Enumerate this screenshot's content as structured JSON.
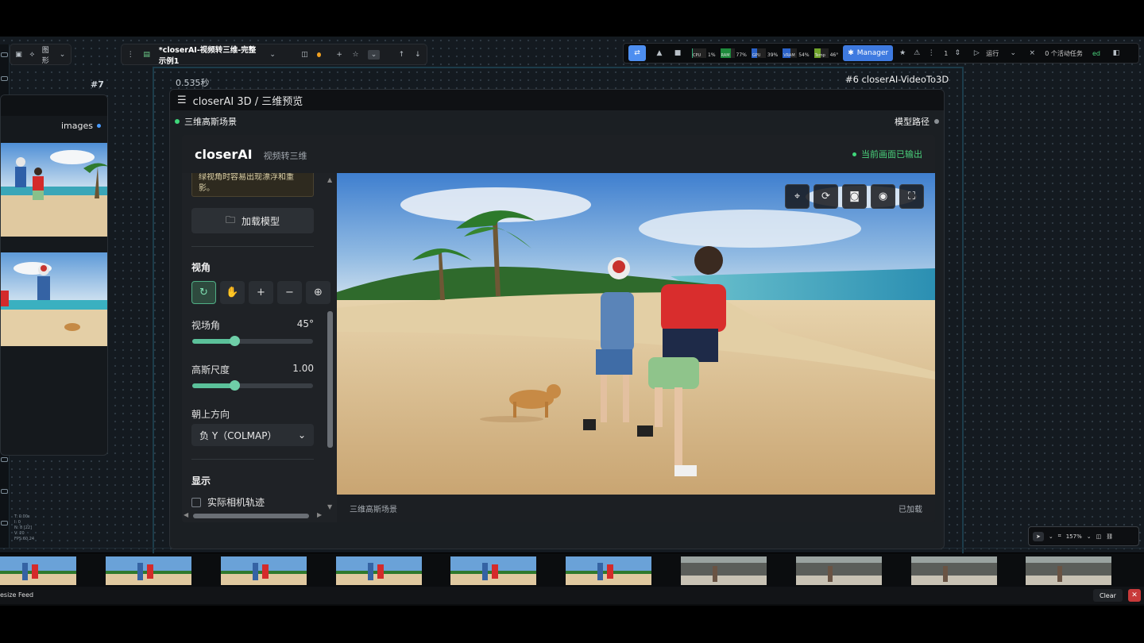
{
  "toolbar": {
    "graph_label": "图形",
    "workflow_tab": "*closerAI-视频转三维-完整示例1"
  },
  "manager_bar": {
    "cpu_value": "1%",
    "cpu_label": "CPU",
    "ram_value": "77%",
    "ram_label": "RAM",
    "gpu_value": "39%",
    "gpu_label": "GPU",
    "vram_value": "54%",
    "vram_label": "VRAM",
    "temp_value": "46°",
    "temp_label": "Temp",
    "manager_label": "Manager",
    "queue_count": "1",
    "run_label": "运行",
    "active_tasks": "0 个活动任务",
    "extra_text": "ed"
  },
  "canvas": {
    "node7_label": "#7",
    "time_label": "0.535秒",
    "node6_title": "#6 closerAI-VideoTo3D"
  },
  "images_node": {
    "output_label": "images"
  },
  "node3d": {
    "title": "closerAI 3D / 三维预览",
    "input_label": "三维高斯场景",
    "output_label": "模型路径"
  },
  "app": {
    "brand": "closerAI",
    "subtitle": "视频转三维",
    "status": "当前画面已输出",
    "hint_text": "绿视角时容易出现漂浮和重影。",
    "load_button": "加载模型",
    "view_section": "视角",
    "fov_label": "视场角",
    "fov_value": "45°",
    "fov_fraction": 0.35,
    "gauss_label": "高斯尺度",
    "gauss_value": "1.00",
    "gauss_fraction": 0.35,
    "up_label": "朝上方向",
    "up_select": "负 Y（COLMAP）",
    "display_section": "显示",
    "camera_track_label": "实际相机轨迹",
    "footer_left": "三维高斯场景",
    "footer_right": "已加载"
  },
  "zoom": {
    "value": "157%"
  },
  "stats": {
    "lines": [
      "T: 0.00s",
      "I: 0",
      "N: 8 [22]",
      "V: 20",
      "FPS:60.24"
    ]
  },
  "feed": {
    "resize_label": "esize Feed",
    "clear_label": "Clear"
  },
  "colors": {
    "accent_green": "#4ad27c",
    "manager_blue": "#3e7ae0",
    "slider_green": "#5bc19a"
  }
}
